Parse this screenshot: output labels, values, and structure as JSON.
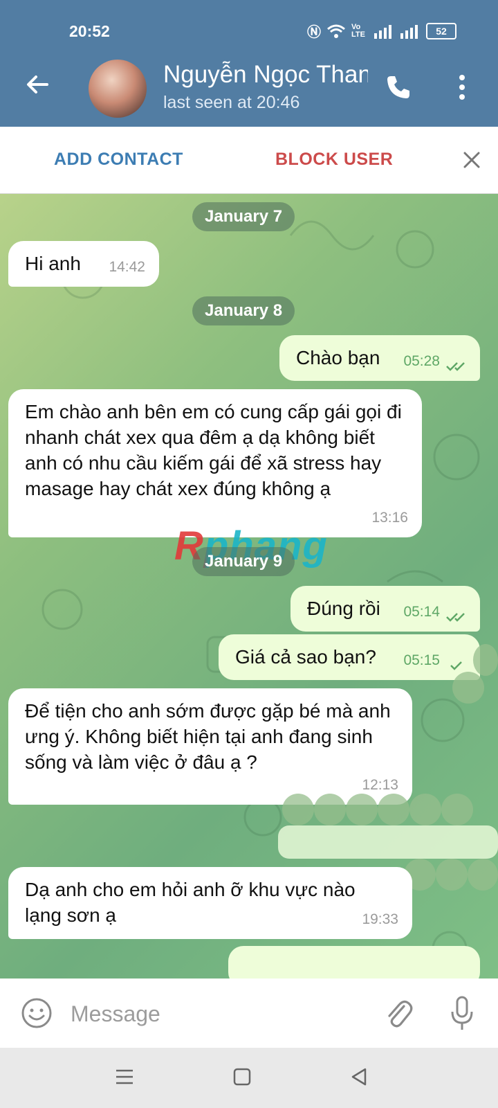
{
  "status_bar": {
    "time": "20:52",
    "network_label": "Vo LTE",
    "battery": "52"
  },
  "header": {
    "contact_name": "Nguyễn Ngọc Thanh",
    "last_seen": "last seen at 20:46"
  },
  "actions": {
    "add_contact": "ADD CONTACT",
    "block_user": "BLOCK USER"
  },
  "chat": {
    "dates": [
      "January 7",
      "January 8",
      "January 9"
    ],
    "messages": [
      {
        "direction": "in",
        "text": "Hi anh",
        "time": "14:42"
      },
      {
        "direction": "out",
        "text": "Chào bạn",
        "time": "05:28",
        "status": "read"
      },
      {
        "direction": "in",
        "text": "Em chào anh bên em có cung cấp gái gọi đi nhanh chát xex qua đêm ạ dạ không biết anh có nhu cầu kiếm gái để xã stress hay masage hay chát xex đúng không ạ",
        "time": "13:16"
      },
      {
        "direction": "out",
        "text": "Đúng rồi",
        "time": "05:14",
        "status": "read"
      },
      {
        "direction": "out",
        "text": "Giá cả sao bạn?",
        "time": "05:15",
        "status": "sent"
      },
      {
        "direction": "in",
        "text": "Để tiện cho anh sớm được gặp bé mà anh ưng ý. Không biết hiện tại anh đang sinh sống và làm việc ở đâu ạ ?",
        "time": "12:13"
      },
      {
        "direction": "in",
        "text": "Dạ anh cho em hỏi anh ỡ khu vực nào lạng sơn ạ",
        "time": "19:33"
      }
    ],
    "watermark": "Rphang"
  },
  "composer": {
    "placeholder": "Message"
  },
  "icons": {
    "back": "arrow-left-icon",
    "call": "phone-icon",
    "menu": "more-vertical-icon",
    "close": "close-icon",
    "emoji": "emoji-icon",
    "attach": "paperclip-icon",
    "mic": "microphone-icon",
    "nav_recents": "menu-lines-icon",
    "nav_home": "square-icon",
    "nav_back": "triangle-back-icon"
  },
  "colors": {
    "header": "#527da3",
    "add_contact": "#3d7db3",
    "block_user": "#cc4b4b",
    "incoming_bubble": "#ffffff",
    "outgoing_bubble": "#eefdd9",
    "outgoing_time": "#5ea766"
  }
}
